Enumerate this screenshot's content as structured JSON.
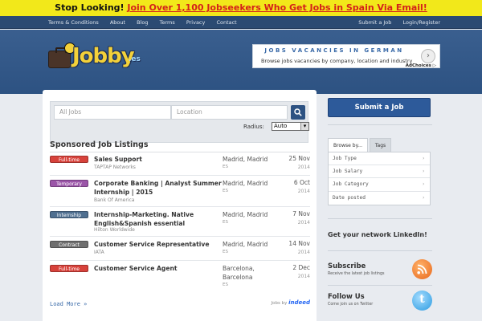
{
  "promo": {
    "lead": "Stop Looking!",
    "link": "Join Over 1,100 Jobseekers Who Get Jobs in Spain Via Email!"
  },
  "topnav": {
    "left": [
      "Terms & Conditions",
      "About",
      "Blog",
      "Terms",
      "Privacy",
      "Contact"
    ],
    "right": [
      "Submit a Job",
      "Login/Register"
    ]
  },
  "logo": {
    "brand": "Jobby",
    "tld": ".es"
  },
  "ad": {
    "title": "JOBS VACANCIES IN GERMAN",
    "text": "Browse jobs vacancies by company, location and industry",
    "choices": "AdChoices ▷"
  },
  "search": {
    "jobs_placeholder": "All Jobs",
    "location_placeholder": "Location",
    "radius_label": "Radius:",
    "radius_value": "Auto"
  },
  "listings": {
    "heading": "Sponsored Job Listings",
    "jobs": [
      {
        "type": "Full-time",
        "color": "#d7423b",
        "title": "Sales Support",
        "company": "TAPTAP Networks",
        "location": "Madrid, Madrid",
        "country": "ES",
        "date": "25 Nov",
        "year": "2014"
      },
      {
        "type": "Temporary",
        "color": "#9b55a8",
        "title": "Corporate Banking | Analyst Summer Internship | 2015",
        "company": "Bank Of America",
        "location": "Madrid, Madrid",
        "country": "ES",
        "date": "6 Oct",
        "year": "2014"
      },
      {
        "type": "Internship",
        "color": "#4f6f90",
        "title": "Internship-Marketing. Native English&Spanish essential",
        "company": "Hilton Worldwide",
        "location": "Madrid, Madrid",
        "country": "ES",
        "date": "7 Nov",
        "year": "2014"
      },
      {
        "type": "Contract",
        "color": "#6f6f6f",
        "title": "Customer Service Representative",
        "company": "IATA",
        "location": "Madrid, Madrid",
        "country": "ES",
        "date": "14 Nov",
        "year": "2014"
      },
      {
        "type": "Full-time",
        "color": "#d7423b",
        "title": "Customer Service Agent",
        "company": "",
        "location": "Barcelona, Barcelona",
        "country": "ES",
        "date": "2 Dec",
        "year": "2014"
      }
    ],
    "load_more": "Load More »",
    "jobs_by": "Jobs by",
    "indeed": "indeed"
  },
  "sidebar": {
    "submit": "Submit a Job",
    "tab_browse": "Browse by...",
    "tab_tags": "Tags",
    "browse_items": [
      "Job Type",
      "Job Salary",
      "Job Category",
      "Date posted"
    ],
    "linkedin": "Get your network LinkedIn!",
    "subscribe_title": "Subscribe",
    "subscribe_sub": "Receive the latest job listings",
    "follow_title": "Follow Us",
    "follow_sub": "Come join us on Twitter"
  }
}
